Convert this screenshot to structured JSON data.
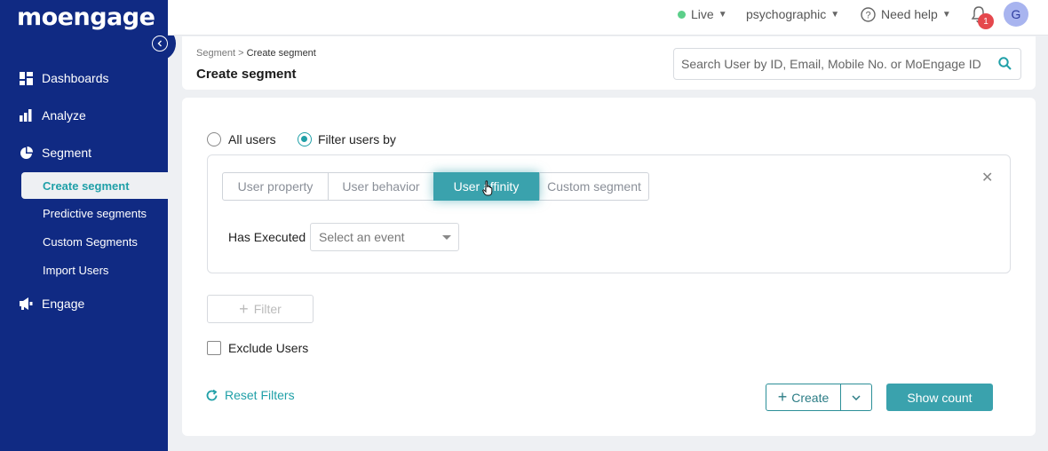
{
  "brand": {
    "logo_text": "moengage"
  },
  "sidebar": {
    "items": [
      {
        "label": "Dashboards",
        "icon": "dashboard-icon"
      },
      {
        "label": "Analyze",
        "icon": "bar-chart-icon"
      },
      {
        "label": "Segment",
        "icon": "pie-chart-icon"
      },
      {
        "label": "Engage",
        "icon": "megaphone-icon"
      }
    ],
    "segment_subitems": [
      {
        "label": "Create segment",
        "active": true
      },
      {
        "label": "Predictive segments"
      },
      {
        "label": "Custom Segments"
      },
      {
        "label": "Import Users"
      }
    ]
  },
  "topbar": {
    "environment": "Live",
    "workspace": "psychographic",
    "help": "Need help",
    "notification_count": "1",
    "avatar_initial": "G"
  },
  "header": {
    "breadcrumb_parent": "Segment",
    "breadcrumb_sep": ">",
    "breadcrumb_current": "Create segment",
    "title": "Create segment",
    "search_placeholder": "Search User by ID, Email, Mobile No. or MoEngage ID"
  },
  "form": {
    "radio_all_users": "All users",
    "radio_filter_users": "Filter users by",
    "tabs": [
      {
        "label": "User property"
      },
      {
        "label": "User behavior"
      },
      {
        "label": "User affinity",
        "active": true
      },
      {
        "label": "Custom segment"
      }
    ],
    "has_executed_label": "Has Executed",
    "event_select_placeholder": "Select an event",
    "add_filter_label": "Filter",
    "exclude_users_label": "Exclude Users",
    "reset_filters_label": "Reset Filters",
    "create_label": "Create",
    "show_count_label": "Show count"
  },
  "colors": {
    "sidebar_bg": "#102a83",
    "accent": "#3aa2ad",
    "live_dot": "#5ccf8a",
    "badge": "#e5484d"
  }
}
